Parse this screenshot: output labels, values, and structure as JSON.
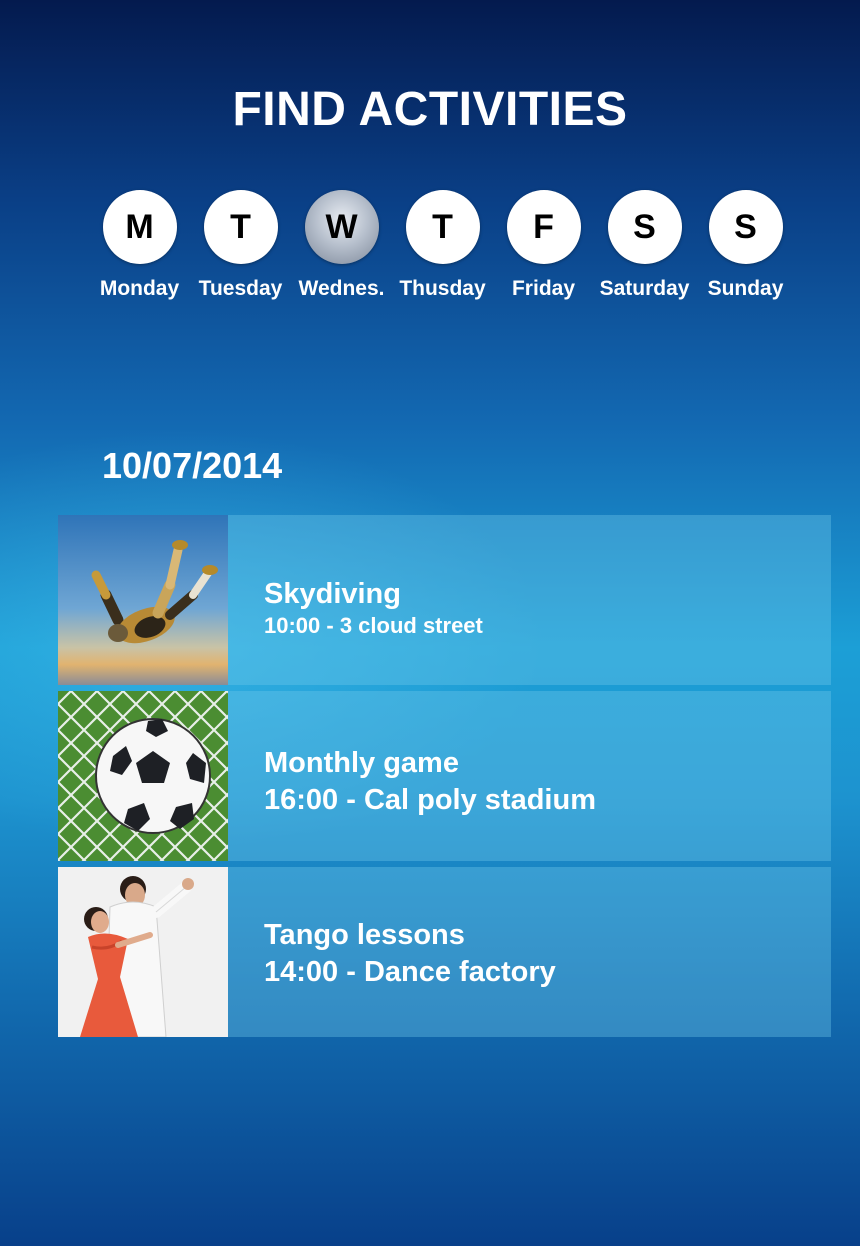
{
  "header": {
    "title": "FIND ACTIVITIES"
  },
  "days": [
    {
      "letter": "M",
      "label": "Monday",
      "selected": false
    },
    {
      "letter": "T",
      "label": "Tuesday",
      "selected": false
    },
    {
      "letter": "W",
      "label": "Wednes.",
      "selected": true
    },
    {
      "letter": "T",
      "label": "Thusday",
      "selected": false
    },
    {
      "letter": "F",
      "label": "Friday",
      "selected": false
    },
    {
      "letter": "S",
      "label": "Saturday",
      "selected": false
    },
    {
      "letter": "S",
      "label": "Sunday",
      "selected": false
    }
  ],
  "date": "10/07/2014",
  "activities": [
    {
      "name": "Skydiving",
      "details": "10:00 - 3 cloud street",
      "image": "skydiver-photo"
    },
    {
      "name": "Monthly game",
      "details": "16:00 - Cal poly stadium",
      "image": "soccer-ball-photo"
    },
    {
      "name": "Tango lessons",
      "details": "14:00 - Dance factory",
      "image": "tango-dancers-photo"
    }
  ],
  "colors": {
    "background_top": "#041a4e",
    "background_mid": "#1c9fd6",
    "background_bottom": "#08408a",
    "day_circle": "#ffffff",
    "day_circle_selected": "#a9b3c2",
    "text": "#ffffff"
  }
}
